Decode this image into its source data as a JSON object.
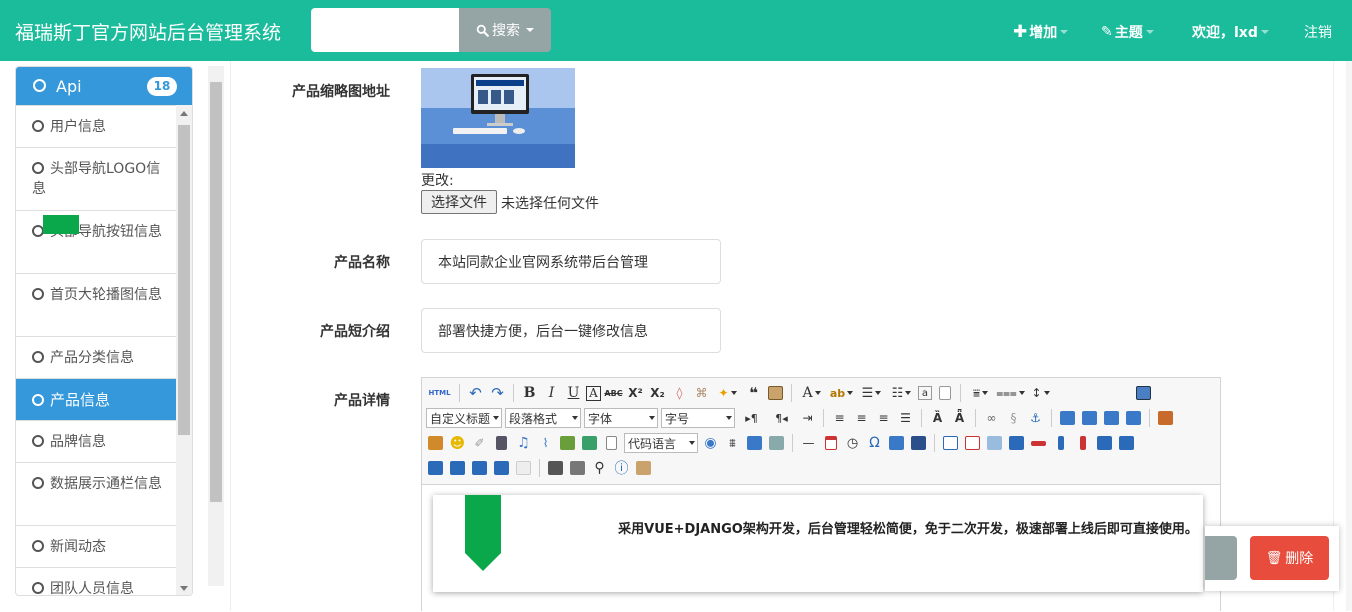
{
  "navbar": {
    "brand": "福瑞斯丁官方网站后台管理系统",
    "search_value": "",
    "search_label": "搜索",
    "add_label": "增加",
    "theme_label": "主题",
    "welcome_label": "欢迎，lxd",
    "logout_label": "注销"
  },
  "sidebar": {
    "header": "Api",
    "badge": "18",
    "items": [
      {
        "label": "用户信息"
      },
      {
        "label": "头部导航LOGO信息"
      },
      {
        "label": "头部导航按钮信息"
      },
      {
        "label": "首页大轮播图信息"
      },
      {
        "label": "产品分类信息"
      },
      {
        "label": "产品信息"
      },
      {
        "label": "品牌信息"
      },
      {
        "label": "数据展示通栏信息"
      },
      {
        "label": "新闻动态"
      },
      {
        "label": "团队人员信息"
      }
    ]
  },
  "form": {
    "thumb_label": "产品缩略图地址",
    "change_label": "更改:",
    "file_button": "选择文件",
    "file_status": "未选择任何文件",
    "name_label": "产品名称",
    "name_value": "本站同款企业官网系统带后台管理",
    "intro_label": "产品短介绍",
    "intro_value": "部署快捷方便，后台一键修改信息",
    "detail_label": "产品详情"
  },
  "editor": {
    "html_btn": "HTML",
    "select_custom_title": "自定义标题",
    "select_paragraph": "段落格式",
    "select_font": "字体",
    "select_size": "字号",
    "select_code": "代码语言",
    "content": "采用VUE+DJANGO架构开发，后台管理轻松简便，免于二次开发，极速部署上线后即可直接使用。"
  },
  "actions": {
    "delete_label": "删除"
  },
  "colors": {
    "navbar": "#1abc9c",
    "sidebar_active": "#3498db",
    "search_button": "#95a5a6",
    "delete_button": "#e74c3c",
    "ribbon": "#0aa84b"
  }
}
